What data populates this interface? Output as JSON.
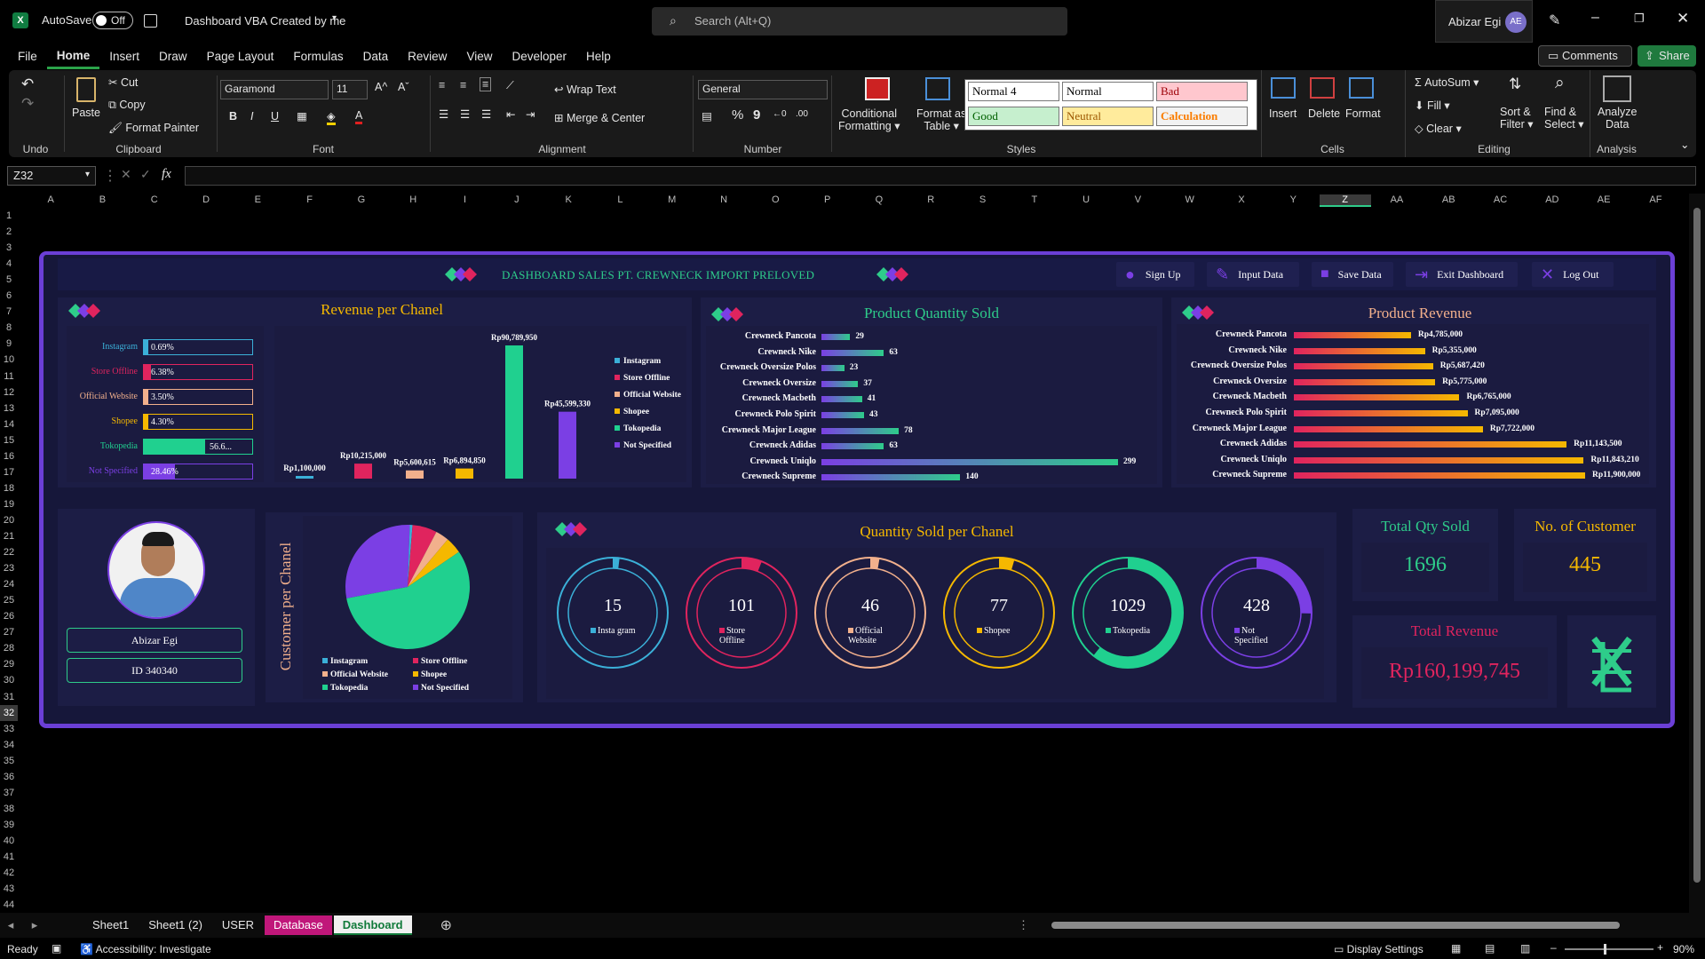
{
  "app": {
    "autosave_label": "AutoSave",
    "autosave_state": "Off",
    "doc_title": "Dashboard VBA Created by me",
    "search_placeholder": "Search (Alt+Q)",
    "user_name": "Abizar Egi",
    "user_initials": "AE"
  },
  "menu": [
    "File",
    "Home",
    "Insert",
    "Draw",
    "Page Layout",
    "Formulas",
    "Data",
    "Review",
    "View",
    "Developer",
    "Help"
  ],
  "menu_right": {
    "comments": "Comments",
    "share": "Share"
  },
  "ribbon": {
    "undo": "Undo",
    "clipboard": {
      "paste": "Paste",
      "cut": "Cut",
      "copy": "Copy",
      "format_painter": "Format Painter",
      "label": "Clipboard"
    },
    "font": {
      "name": "Garamond",
      "size": "11",
      "label": "Font",
      "bold": "B",
      "italic": "I",
      "underline": "U"
    },
    "alignment": {
      "wrap": "Wrap Text",
      "merge": "Merge & Center",
      "label": "Alignment"
    },
    "number": {
      "format": "General",
      "label": "Number",
      "percent": "%",
      "comma": "9"
    },
    "styles": {
      "conditional": "Conditional",
      "conditional2": "Formatting",
      "format_as": "Format as",
      "format_as2": "Table",
      "cells": [
        "Normal 4",
        "Normal",
        "Bad",
        "Good",
        "Neutral",
        "Calculation"
      ],
      "label": "Styles"
    },
    "cells": {
      "insert": "Insert",
      "delete": "Delete",
      "format": "Format",
      "label": "Cells"
    },
    "editing": {
      "autosum": "AutoSum",
      "fill": "Fill",
      "clear": "Clear",
      "sort": "Sort &",
      "sort2": "Filter",
      "find": "Find &",
      "find2": "Select",
      "label": "Editing"
    },
    "analysis": {
      "analyze": "Analyze",
      "analyze2": "Data",
      "label": "Analysis"
    }
  },
  "namebox": "Z32",
  "fx": "fx",
  "columns": [
    "A",
    "B",
    "C",
    "D",
    "E",
    "F",
    "G",
    "H",
    "I",
    "J",
    "K",
    "L",
    "M",
    "N",
    "O",
    "P",
    "Q",
    "R",
    "S",
    "T",
    "U",
    "V",
    "W",
    "X",
    "Y",
    "Z",
    "AA",
    "AB",
    "AC",
    "AD",
    "AE",
    "AF"
  ],
  "rows": [
    "1",
    "2",
    "3",
    "4",
    "5",
    "6",
    "7",
    "8",
    "9",
    "10",
    "11",
    "12",
    "13",
    "14",
    "15",
    "16",
    "17",
    "18",
    "19",
    "20",
    "21",
    "22",
    "23",
    "24",
    "25",
    "26",
    "27",
    "28",
    "29",
    "30",
    "31",
    "32",
    "33",
    "34",
    "35",
    "36",
    "37",
    "38",
    "39",
    "40",
    "41",
    "42",
    "43",
    "44"
  ],
  "dashboard": {
    "title": "DASHBOARD SALES PT. CREWNECK IMPORT PRELOVED",
    "buttons": [
      "Sign Up",
      "Input Data",
      "Save Data",
      "Exit Dashboard",
      "Log Out"
    ],
    "revenue_title": "Revenue per Chanel",
    "qty_title": "Product Quantity Sold",
    "prodrev_title": "Product Revenue",
    "qty_channel_title": "Quantity Sold per Chanel",
    "customer_title": "Customer per Chanel",
    "total_qty_title": "Total Qty Sold",
    "total_qty": "1696",
    "no_customer_title": "No. of Customer",
    "no_customer": "445",
    "total_revenue_title": "Total Revenue",
    "total_revenue": "Rp160,199,745",
    "profile_name": "Abizar Egi",
    "profile_id": "ID 340340",
    "channel_pct": [
      {
        "name": "Instagram",
        "pct": "0.69%",
        "frac": 0.0069,
        "color": "#3bb0d8"
      },
      {
        "name": "Store Offline",
        "pct": "6.38%",
        "frac": 0.0638,
        "color": "#e0245e"
      },
      {
        "name": "Official Website",
        "pct": "3.50%",
        "frac": 0.035,
        "color": "#f2b08c"
      },
      {
        "name": "Shopee",
        "pct": "4.30%",
        "frac": 0.043,
        "color": "#f5b800"
      },
      {
        "name": "Tokopedia",
        "pct": "56.6...",
        "frac": 0.566,
        "color": "#20d08f"
      },
      {
        "name": "Not Specified",
        "pct": "28.46%",
        "frac": 0.2846,
        "color": "#7b3fe4"
      }
    ]
  },
  "chart_data": [
    {
      "type": "bar",
      "title": "Revenue per Chanel",
      "categories": [
        "Instagram",
        "Store Offline",
        "Official Website",
        "Shopee",
        "Tokopedia",
        "Not Specified"
      ],
      "values": [
        1100000,
        10215000,
        5600615,
        6894850,
        90789950,
        45599330
      ],
      "labels": [
        "Rp1,100,000",
        "Rp10,215,000",
        "Rp5,600,615",
        "Rp6,894,850",
        "Rp90,789,950",
        "Rp45,599,330"
      ],
      "colors": [
        "#3bb0d8",
        "#e0245e",
        "#f2b08c",
        "#f5b800",
        "#20d08f",
        "#7b3fe4"
      ]
    },
    {
      "type": "bar",
      "title": "Product Quantity Sold",
      "categories": [
        "Crewneck Pancota",
        "Crewneck Nike",
        "Crewneck Oversize Polos",
        "Crewneck Oversize",
        "Crewneck Macbeth",
        "Crewneck Polo Spirit",
        "Crewneck Major League",
        "Crewneck Adidas",
        "Crewneck Uniqlo",
        "Crewneck Supreme"
      ],
      "values": [
        29,
        63,
        23,
        37,
        41,
        43,
        78,
        63,
        299,
        140
      ]
    },
    {
      "type": "bar",
      "title": "Product Revenue",
      "categories": [
        "Crewneck Pancota",
        "Crewneck Nike",
        "Crewneck Oversize Polos",
        "Crewneck Oversize",
        "Crewneck Macbeth",
        "Crewneck Polo Spirit",
        "Crewneck Major League",
        "Crewneck Adidas",
        "Crewneck Uniqlo",
        "Crewneck Supreme"
      ],
      "values": [
        4785000,
        5355000,
        5687420,
        5775000,
        6765000,
        7095000,
        7722000,
        11143500,
        11843210,
        11900000
      ],
      "labels": [
        "Rp4,785,000",
        "Rp5,355,000",
        "Rp5,687,420",
        "Rp5,775,000",
        "Rp6,765,000",
        "Rp7,095,000",
        "Rp7,722,000",
        "Rp11,143,500",
        "Rp11,843,210",
        "Rp11,900,000"
      ]
    },
    {
      "type": "pie",
      "title": "Customer per Chanel",
      "categories": [
        "Instagram",
        "Store Offline",
        "Official Website",
        "Shopee",
        "Tokopedia",
        "Not Specified"
      ],
      "values": [
        0.7,
        6.4,
        3.5,
        4.3,
        56.6,
        28.5
      ],
      "colors": [
        "#3bb0d8",
        "#e0245e",
        "#f2b08c",
        "#f5b800",
        "#20d08f",
        "#7b3fe4"
      ]
    },
    {
      "type": "pie",
      "title": "Quantity Sold per Chanel",
      "categories": [
        "Instagram",
        "Store Offline",
        "Official Website",
        "Shopee",
        "Tokopedia",
        "Not Specified"
      ],
      "values": [
        15,
        101,
        46,
        77,
        1029,
        428
      ],
      "ring_labels": [
        "Insta gram",
        "Store Offline",
        "Official Website",
        "Shopee",
        "Tokopedia",
        "Not Specified"
      ],
      "colors": [
        "#3bb0d8",
        "#e0245e",
        "#f2b08c",
        "#f5b800",
        "#20d08f",
        "#7b3fe4"
      ],
      "fractions": [
        0.009,
        0.06,
        0.027,
        0.045,
        0.607,
        0.252
      ]
    }
  ],
  "sheets": [
    "Sheet1",
    "Sheet1 (2)",
    "USER",
    "Database",
    "Dashboard"
  ],
  "status": {
    "ready": "Ready",
    "accessibility": "Accessibility: Investigate",
    "display": "Display Settings",
    "zoom": "90%"
  }
}
